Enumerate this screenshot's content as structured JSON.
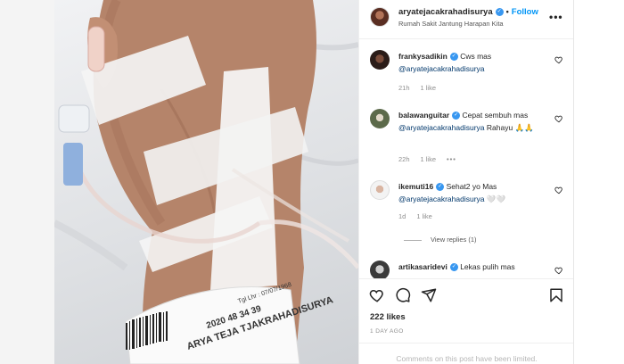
{
  "post": {
    "username": "aryatejacakrahadisurya",
    "follow_label": "Follow",
    "location": "Rumah Sakit Jantung Harapan Kita",
    "wristband_lines": [
      "ARYA TEJA TJAKRAHADISURYA",
      "2020 48 34 39",
      "Tgl Lhr : 07/07/1968"
    ]
  },
  "comments": [
    {
      "user": "frankysadikin",
      "text_pre": "Cws mas ",
      "mention": "@aryatejacakrahadisurya",
      "text_post": "",
      "time": "21h",
      "likes": "1 like",
      "more": ""
    },
    {
      "user": "balawanguitar",
      "text_pre": "Cepat sembuh mas ",
      "mention": "@aryatejacakrahadisurya",
      "text_post": " Rahayu 🙏🙏",
      "time": "22h",
      "likes": "1 like",
      "more": "•••"
    },
    {
      "user": "ikemuti16",
      "text_pre": "Sehat2 yo Mas ",
      "mention": "@aryatejacakrahadisurya",
      "text_post": " 🤍🤍",
      "time": "1d",
      "likes": "1 like",
      "more": ""
    },
    {
      "user": "artikasaridevi",
      "text_pre": "Lekas pulih mas",
      "mention": "",
      "text_post": "",
      "time": "",
      "likes": "",
      "more": ""
    }
  ],
  "view_replies": "View replies (1)",
  "likes": "222 likes",
  "date": "1 DAY AGO",
  "comments_limited": "Comments on this post have been limited.",
  "icons": {
    "verified": "verified-badge-icon",
    "heart": "heart-icon",
    "comment": "comment-icon",
    "share": "send-icon",
    "save": "bookmark-icon",
    "more": "more-icon"
  }
}
